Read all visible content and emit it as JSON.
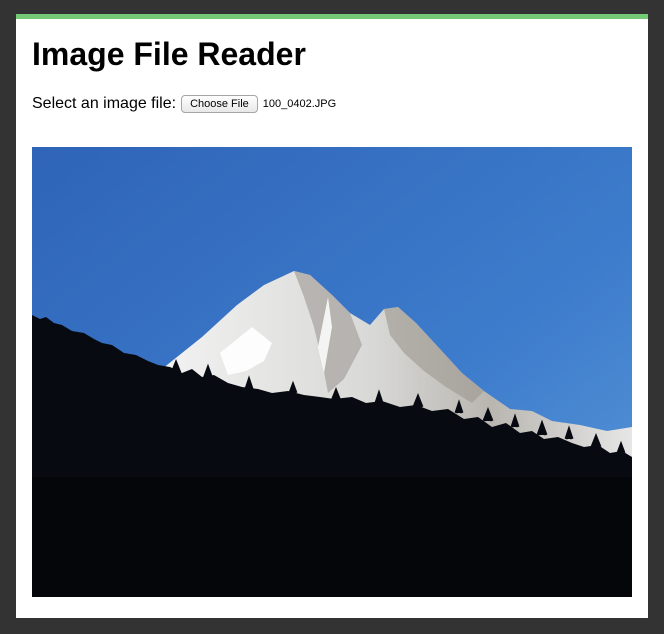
{
  "page": {
    "title": "Image File Reader",
    "accent_color": "#74c974"
  },
  "file_picker": {
    "label": "Select an image file:",
    "button_label": "Choose File",
    "selected_file": "100_0402.JPG"
  },
  "preview": {
    "description_icon": "mountain-photo"
  }
}
